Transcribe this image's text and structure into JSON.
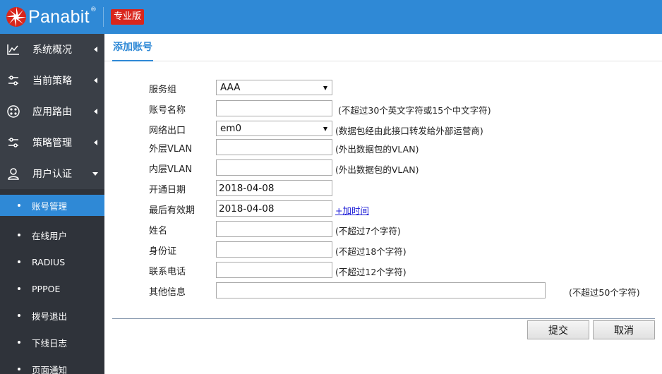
{
  "header": {
    "brand": "Panabit",
    "reg_mark": "®",
    "edition": "专业版"
  },
  "sidebar": {
    "items": [
      {
        "label": "系统概况",
        "icon": "chart-line-icon"
      },
      {
        "label": "当前策略",
        "icon": "sliders-icon"
      },
      {
        "label": "应用路由",
        "icon": "route-icon"
      },
      {
        "label": "策略管理",
        "icon": "sliders-icon"
      },
      {
        "label": "用户认证",
        "icon": "user-icon"
      }
    ],
    "subitems": [
      {
        "label": "账号管理",
        "active": true
      },
      {
        "label": "在线用户"
      },
      {
        "label": "RADIUS"
      },
      {
        "label": "PPPOE"
      },
      {
        "label": "拨号退出"
      },
      {
        "label": "下线日志"
      },
      {
        "label": "页面通知"
      }
    ]
  },
  "main": {
    "tab": "添加账号",
    "form": {
      "service_group": {
        "label": "服务组",
        "value": "AAA"
      },
      "account_name": {
        "label": "账号名称",
        "value": "",
        "hint": "(不超过30个英文字符或15个中文字符)"
      },
      "network_exit": {
        "label": "网络出口",
        "value": "em0",
        "hint": "(数据包经由此接口转发给外部运营商)"
      },
      "outer_vlan": {
        "label": "外层VLAN",
        "value": "",
        "hint": "(外出数据包的VLAN)"
      },
      "inner_vlan": {
        "label": "内层VLAN",
        "value": "",
        "hint": "(外出数据包的VLAN)"
      },
      "open_date": {
        "label": "开通日期",
        "value": "2018-04-08"
      },
      "expire_date": {
        "label": "最后有效期",
        "value": "2018-04-08",
        "link": "+加时间"
      },
      "name": {
        "label": "姓名",
        "value": "",
        "hint": "(不超过7个字符)"
      },
      "id_card": {
        "label": "身份证",
        "value": "",
        "hint": "(不超过18个字符)"
      },
      "phone": {
        "label": "联系电话",
        "value": "",
        "hint": "(不超过12个字符)"
      },
      "other": {
        "label": "其他信息",
        "value": "",
        "hint": "(不超过50个字符)"
      }
    },
    "buttons": {
      "submit": "提交",
      "cancel": "取消"
    }
  },
  "colors": {
    "accent": "#2f89d6",
    "sidebar": "#3a3f47",
    "edition_badge": "#d9261c"
  }
}
